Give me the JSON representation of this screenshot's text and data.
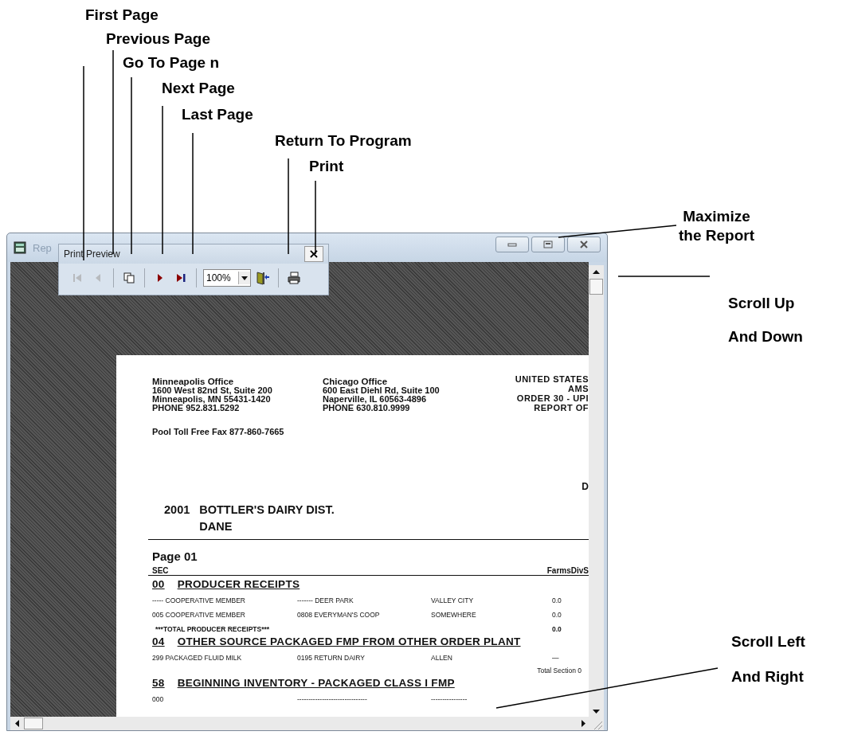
{
  "annotations": [
    {
      "lines": [
        "First Page"
      ]
    },
    {
      "lines": [
        "Previous Page"
      ]
    },
    {
      "lines": [
        "Go To Page n"
      ]
    },
    {
      "lines": [
        "Next Page"
      ]
    },
    {
      "lines": [
        "Last Page"
      ]
    },
    {
      "lines": [
        "Return To Program"
      ]
    },
    {
      "lines": [
        "Print"
      ]
    },
    {
      "lines": [
        "Maximize",
        "the Report"
      ]
    },
    {
      "lines": [
        "Scroll Up",
        "And Down"
      ]
    },
    {
      "lines": [
        "Scroll Left",
        "And Right"
      ]
    }
  ],
  "window": {
    "title": "Rep"
  },
  "toolbar": {
    "title": "Print Preview",
    "close": "×",
    "buttons": [
      {
        "kind": "first",
        "disabled": true
      },
      {
        "kind": "previous",
        "disabled": true
      },
      {
        "kind": "goto",
        "disabled": false
      },
      {
        "kind": "next",
        "disabled": false
      },
      {
        "kind": "last",
        "disabled": false
      },
      {
        "kind": "zoom",
        "value": "100%"
      },
      {
        "kind": "return",
        "disabled": false
      },
      {
        "kind": "print",
        "disabled": false
      }
    ]
  },
  "report": {
    "offices": [
      {
        "lines": [
          "Minneapolis Office",
          "1600 West 82nd St, Suite 200",
          "Minneapolis, MN  55431-1420",
          "PHONE   952.831.5292"
        ]
      },
      {
        "lines": [
          "Chicago Office",
          "600 East Diehl Rd, Suite 100",
          "Naperville, IL  60563-4896",
          "PHONE   630.810.9999"
        ]
      }
    ],
    "heading_lines": [
      "UNITED STATES",
      "AMS",
      "ORDER 30 - UPI",
      "REPORT OF"
    ],
    "fax": "Pool Toll Free Fax 877-860-7665",
    "date_fragment": "D",
    "handler_code": "2001",
    "handler_name": "BOTTLER'S DAIRY DIST.",
    "handler_county": "DANE",
    "page_label": "Page 01",
    "columns": [
      "SEC",
      "FarmsDivS"
    ],
    "sections": [
      {
        "code": "00",
        "title": "PRODUCER RECEIPTS",
        "rows": [
          {
            "kind": "line",
            "cells": [
              "----- COOPERATIVE MEMBER",
              "------- DEER PARK",
              "VALLEY CITY",
              "0.0"
            ]
          },
          {
            "kind": "line",
            "cells": [
              "005 COOPERATIVE MEMBER",
              "0808 EVERYMAN'S COOP",
              "SOMEWHERE",
              "0.0"
            ]
          },
          {
            "kind": "total",
            "cells": [
              "***TOTAL PRODUCER RECEIPTS***",
              "",
              "",
              "0.0"
            ]
          }
        ]
      },
      {
        "code": "04",
        "title": "OTHER SOURCE PACKAGED FMP FROM OTHER ORDER PLANT",
        "rows": [
          {
            "kind": "line",
            "cells": [
              "299 PACKAGED FLUID MILK",
              "0195 RETURN DAIRY",
              "ALLEN",
              "—"
            ]
          },
          {
            "kind": "subtotal",
            "cells": [
              "",
              "",
              "",
              "Total Section 0"
            ]
          }
        ]
      },
      {
        "code": "58",
        "title": "BEGINNING INVENTORY - PACKAGED CLASS I FMP",
        "rows": [
          {
            "kind": "line",
            "cells": [
              "000",
              "-------------------------------",
              "----------------"
            ]
          }
        ]
      }
    ]
  }
}
